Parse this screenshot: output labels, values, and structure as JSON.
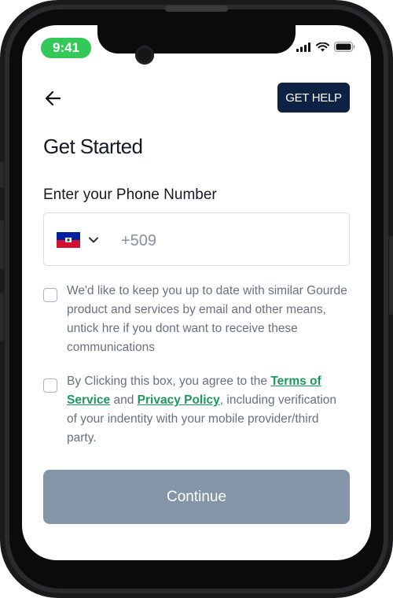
{
  "status_bar": {
    "time": "9:41",
    "icons": [
      "cellular-signal-icon",
      "wifi-icon",
      "battery-icon"
    ]
  },
  "header": {
    "back_icon": "arrow-left-icon",
    "help_label": "GET HELP"
  },
  "title": "Get Started",
  "phone": {
    "label": "Enter your Phone Number",
    "country_flag": "haiti-flag-icon",
    "dial_code": "+509",
    "value": ""
  },
  "consents": {
    "marketing": {
      "checked": false,
      "text": "We'd like to keep you up to date with similar Gourde product and services by email and other means, untick hre if you dont want to receive these communications"
    },
    "terms": {
      "checked": false,
      "text_before": "By Clicking this box, you agree to the ",
      "terms_link": "Terms of Service",
      "text_middle": " and ",
      "privacy_link": "Privacy Policy",
      "text_after": ", including verification of your indentity with your mobile provider/third party."
    }
  },
  "continue_label": "Continue",
  "colors": {
    "primary": "#0e2244",
    "status_green": "#34c759",
    "link_green": "#1a9a5c",
    "button_disabled": "#8595a8"
  }
}
